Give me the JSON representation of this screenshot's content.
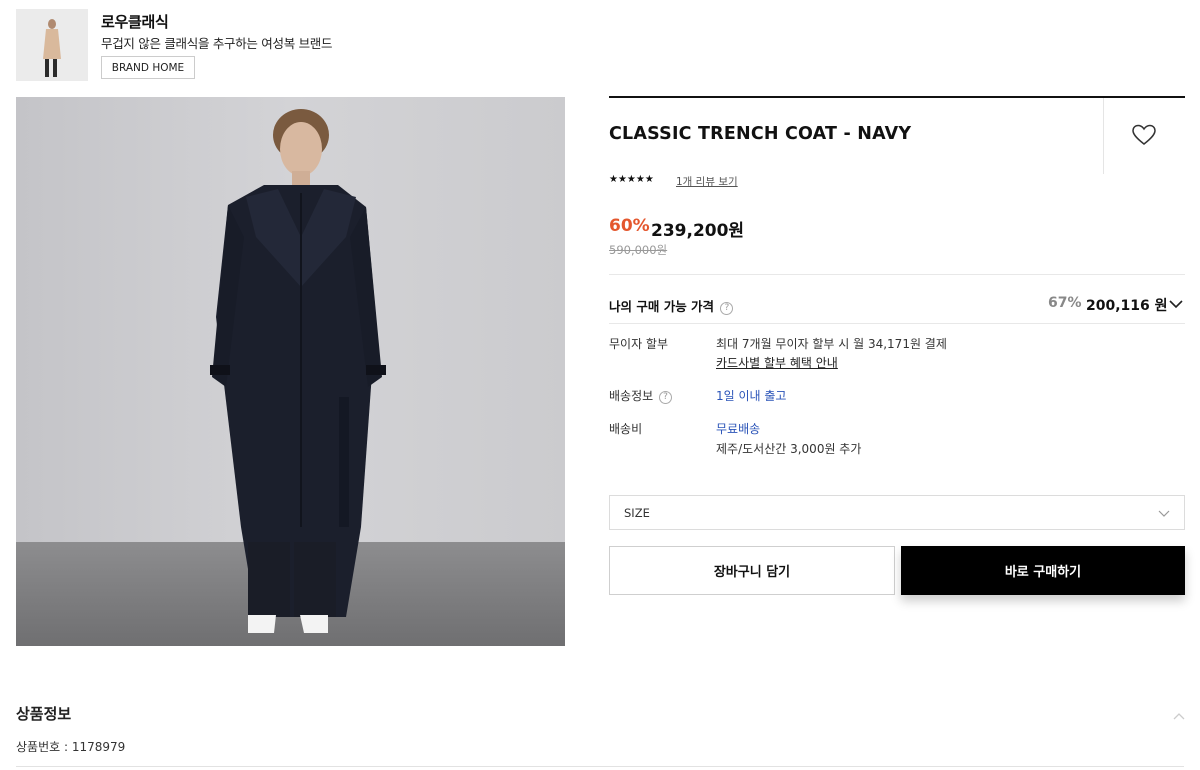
{
  "brand": {
    "name": "로우클래식",
    "description": "무겁지 않은 클래식을 추구하는 여성복 브랜드",
    "home_label": "BRAND HOME"
  },
  "product": {
    "title": "CLASSIC TRENCH COAT - NAVY",
    "rating_stars": "★★★★★",
    "rating_value": 5,
    "review_link": "1개 리뷰 보기",
    "discount": "60%",
    "price": "239,200원",
    "original_price": "590,000원"
  },
  "my_buy": {
    "label": "나의 구매 가능 가격",
    "help": "?",
    "discount": "67%",
    "price": "200,116 원"
  },
  "details": {
    "installment_label": "무이자 할부",
    "installment_text": "최대 7개월 무이자 할부 시 월 34,171원 결제",
    "installment_link": "카드사별 할부 혜택 안내",
    "shipping_label": "배송정보",
    "shipping_help": "?",
    "shipping_text": "1일 이내 출고",
    "fee_label": "배송비",
    "fee_text": "무료배송",
    "fee_note": "제주/도서산간 3,000원 추가"
  },
  "size_select": {
    "placeholder": "SIZE"
  },
  "buttons": {
    "cart": "장바구니 담기",
    "buy": "바로 구매하기"
  },
  "info_section": {
    "title": "상품정보",
    "product_number": "상품번호 : 1178979"
  },
  "colors": {
    "accent": "#e4572e",
    "link_blue": "#2b54b8",
    "buy_button": "#000000"
  }
}
